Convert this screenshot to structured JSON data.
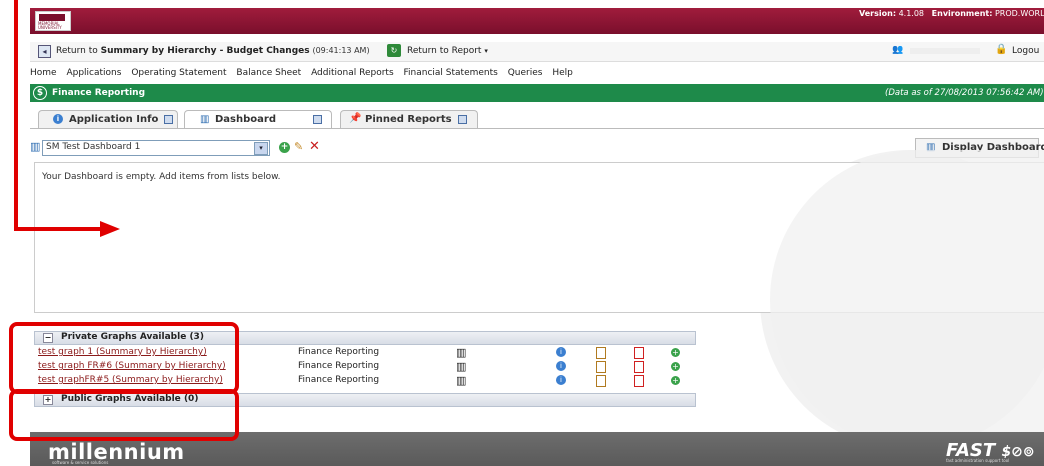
{
  "header": {
    "logo_text": "MEMORIAL UNIVERSITY",
    "version_label": "Version:",
    "version_value": "4.1.08",
    "env_label": "Environment:",
    "env_value": "PROD.WORLD"
  },
  "navbar": {
    "return_prefix": "Return to ",
    "return_target": "Summary by Hierarchy - Budget Changes",
    "return_time": "(09:41:13 AM)",
    "return_report": "Return to Report",
    "logout": "Logou"
  },
  "menu": [
    "Home",
    "Applications",
    "Operating Statement",
    "Balance Sheet",
    "Additional Reports",
    "Financial Statements",
    "Queries",
    "Help"
  ],
  "finance_bar": {
    "title": "Finance Reporting",
    "data_as_of": "(Data as of 27/08/2013 07:56:42 AM)"
  },
  "tabs": [
    {
      "label": "Application Info"
    },
    {
      "label": "Dashboard"
    },
    {
      "label": "Pinned Reports"
    }
  ],
  "dashboard": {
    "selected": "SM Test Dashboard 1",
    "display_button": "Display Dashboard",
    "empty_message": "Your Dashboard is empty. Add items from lists below."
  },
  "private_graphs": {
    "title": "Private Graphs Available",
    "count": "(3)",
    "rows": [
      {
        "name": "test graph 1 (Summary by Hierarchy)",
        "app": "Finance Reporting"
      },
      {
        "name": "test graph FR#6 (Summary by Hierarchy)",
        "app": "Finance Reporting"
      },
      {
        "name": "test graphFR#5 (Summary by Hierarchy)",
        "app": "Finance Reporting"
      }
    ]
  },
  "public_graphs": {
    "title": "Public Graphs Available",
    "count": "(0)"
  },
  "footer": {
    "brand": "millennium",
    "brand_sub": "software & service solutions",
    "fast": "FAST",
    "fast_sub": "fast administration support tool"
  },
  "colors": {
    "brand": "#7a0f2c",
    "finance_green": "#1e8a4a",
    "annotation_red": "#e00000",
    "link": "#8b1a1a"
  }
}
